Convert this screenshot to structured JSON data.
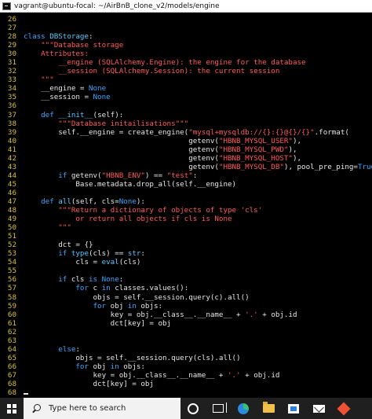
{
  "window": {
    "title": "vagrant@ubuntu-focal: ~/AirBnB_clone_v2/models/engine"
  },
  "code": {
    "lines": [
      {
        "n": "26",
        "t": []
      },
      {
        "n": "27",
        "t": []
      },
      {
        "n": "28",
        "t": [
          [
            "kw",
            "class "
          ],
          [
            "cls",
            "DBStorage"
          ],
          [
            "",
            ":"
          ]
        ]
      },
      {
        "n": "29",
        "t": [
          [
            "str",
            "    \"\"\"Database storage"
          ]
        ]
      },
      {
        "n": "30",
        "t": [
          [
            "str",
            "    Attributes:"
          ]
        ]
      },
      {
        "n": "31",
        "t": [
          [
            "str",
            "        __engine (SQLAlchemy.Engine): the engine for the database"
          ]
        ]
      },
      {
        "n": "32",
        "t": [
          [
            "str",
            "        __session (SQLAlchemy.Session): the current session"
          ]
        ]
      },
      {
        "n": "33",
        "t": [
          [
            "str",
            "    \"\"\""
          ]
        ]
      },
      {
        "n": "34",
        "t": [
          [
            "",
            "    __engine = "
          ],
          [
            "kw",
            "None"
          ]
        ]
      },
      {
        "n": "35",
        "t": [
          [
            "",
            "    __session = "
          ],
          [
            "kw",
            "None"
          ]
        ]
      },
      {
        "n": "36",
        "t": []
      },
      {
        "n": "37",
        "t": [
          [
            "kw",
            "    def "
          ],
          [
            "cls",
            "__init__"
          ],
          [
            "",
            "(self):"
          ]
        ]
      },
      {
        "n": "38",
        "t": [
          [
            "str",
            "        \"\"\"Database initailisations\"\"\""
          ]
        ]
      },
      {
        "n": "39",
        "t": [
          [
            "",
            "        self.__engine = create_engine("
          ],
          [
            "str",
            "\"mysql+mysqldb://{}:{}@{}/{}\""
          ],
          [
            "",
            ".format("
          ]
        ]
      },
      {
        "n": "40",
        "t": [
          [
            "",
            "                                      getenv("
          ],
          [
            "str",
            "\"HBNB_MYSQL_USER\""
          ],
          [
            "",
            "),"
          ]
        ]
      },
      {
        "n": "41",
        "t": [
          [
            "",
            "                                      getenv("
          ],
          [
            "str",
            "\"HBNB_MYSQL_PWD\""
          ],
          [
            "",
            "),"
          ]
        ]
      },
      {
        "n": "42",
        "t": [
          [
            "",
            "                                      getenv("
          ],
          [
            "str",
            "\"HBNB_MYSQL_HOST\""
          ],
          [
            "",
            "),"
          ]
        ]
      },
      {
        "n": "43",
        "t": [
          [
            "",
            "                                      getenv("
          ],
          [
            "str",
            "\"HBNB_MYSQL_DB\""
          ],
          [
            "",
            "), pool_pre_ping="
          ],
          [
            "kw",
            "True"
          ],
          [
            "",
            "))"
          ]
        ]
      },
      {
        "n": "44",
        "t": [
          [
            "kw",
            "        if "
          ],
          [
            "",
            "getenv("
          ],
          [
            "str",
            "\"HBNB_ENV\""
          ],
          [
            "",
            ") == "
          ],
          [
            "str",
            "\"test\""
          ],
          [
            "",
            ":"
          ]
        ]
      },
      {
        "n": "45",
        "t": [
          [
            "",
            "            Base.metadata.drop_all(self.__engine)"
          ]
        ]
      },
      {
        "n": "46",
        "t": []
      },
      {
        "n": "47",
        "t": [
          [
            "kw",
            "    def "
          ],
          [
            "cls",
            "all"
          ],
          [
            "",
            "(self, cls="
          ],
          [
            "kw",
            "None"
          ],
          [
            "",
            "):"
          ]
        ]
      },
      {
        "n": "48",
        "t": [
          [
            "str",
            "        \"\"\"Return a dictionary of objects of type 'cls'"
          ]
        ]
      },
      {
        "n": "49",
        "t": [
          [
            "str",
            "            or return all objects if cls is None"
          ]
        ]
      },
      {
        "n": "50",
        "t": [
          [
            "str",
            "        \"\"\""
          ]
        ]
      },
      {
        "n": "51",
        "t": []
      },
      {
        "n": "52",
        "t": [
          [
            "",
            "        dct = {}"
          ]
        ]
      },
      {
        "n": "53",
        "t": [
          [
            "kw",
            "        if "
          ],
          [
            "bi",
            "type"
          ],
          [
            "",
            "(cls) == "
          ],
          [
            "bi",
            "str"
          ],
          [
            "",
            ":"
          ]
        ]
      },
      {
        "n": "54",
        "t": [
          [
            "",
            "            cls = "
          ],
          [
            "bi",
            "eval"
          ],
          [
            "",
            "(cls)"
          ]
        ]
      },
      {
        "n": "55",
        "t": []
      },
      {
        "n": "56",
        "t": [
          [
            "kw",
            "        if "
          ],
          [
            "",
            "cls "
          ],
          [
            "kw",
            "is None"
          ],
          [
            "",
            ":"
          ]
        ]
      },
      {
        "n": "57",
        "t": [
          [
            "kw",
            "            for "
          ],
          [
            "",
            "c "
          ],
          [
            "kw",
            "in "
          ],
          [
            "",
            "classes.values():"
          ]
        ]
      },
      {
        "n": "58",
        "t": [
          [
            "",
            "                objs = self.__session.query(c).all()"
          ]
        ]
      },
      {
        "n": "59",
        "t": [
          [
            "kw",
            "                for "
          ],
          [
            "",
            "obj "
          ],
          [
            "kw",
            "in "
          ],
          [
            "",
            "objs:"
          ]
        ]
      },
      {
        "n": "60",
        "t": [
          [
            "",
            "                    key = obj.__class__.__name__ + "
          ],
          [
            "str",
            "'.'"
          ],
          [
            "",
            " + obj.id"
          ]
        ]
      },
      {
        "n": "61",
        "t": [
          [
            "",
            "                    dct[key] = obj"
          ]
        ]
      },
      {
        "n": "62",
        "t": []
      },
      {
        "n": "63",
        "t": []
      },
      {
        "n": "64",
        "t": [
          [
            "kw",
            "        else"
          ],
          [
            "",
            ":"
          ]
        ]
      },
      {
        "n": "65",
        "t": [
          [
            "",
            "            objs = self.__session.query(cls).all()"
          ]
        ]
      },
      {
        "n": "66",
        "t": [
          [
            "kw",
            "            for "
          ],
          [
            "",
            "obj "
          ],
          [
            "kw",
            "in "
          ],
          [
            "",
            "objs:"
          ]
        ]
      },
      {
        "n": "67",
        "t": [
          [
            "",
            "                key = obj.__class__.__name__ + "
          ],
          [
            "str",
            "'.'"
          ],
          [
            "",
            " + obj.id"
          ]
        ]
      },
      {
        "n": "68",
        "t": [
          [
            "",
            "                dct[key] = obj"
          ]
        ]
      },
      {
        "n": "68",
        "t": [],
        "cursor": true
      }
    ]
  },
  "taskbar": {
    "search_placeholder": "Type here to search",
    "icons": [
      "windows-icon",
      "search-icon",
      "cortana-icon",
      "task-view-icon",
      "edge-icon",
      "file-explorer-icon",
      "store-icon",
      "mail-icon",
      "git-icon"
    ]
  }
}
